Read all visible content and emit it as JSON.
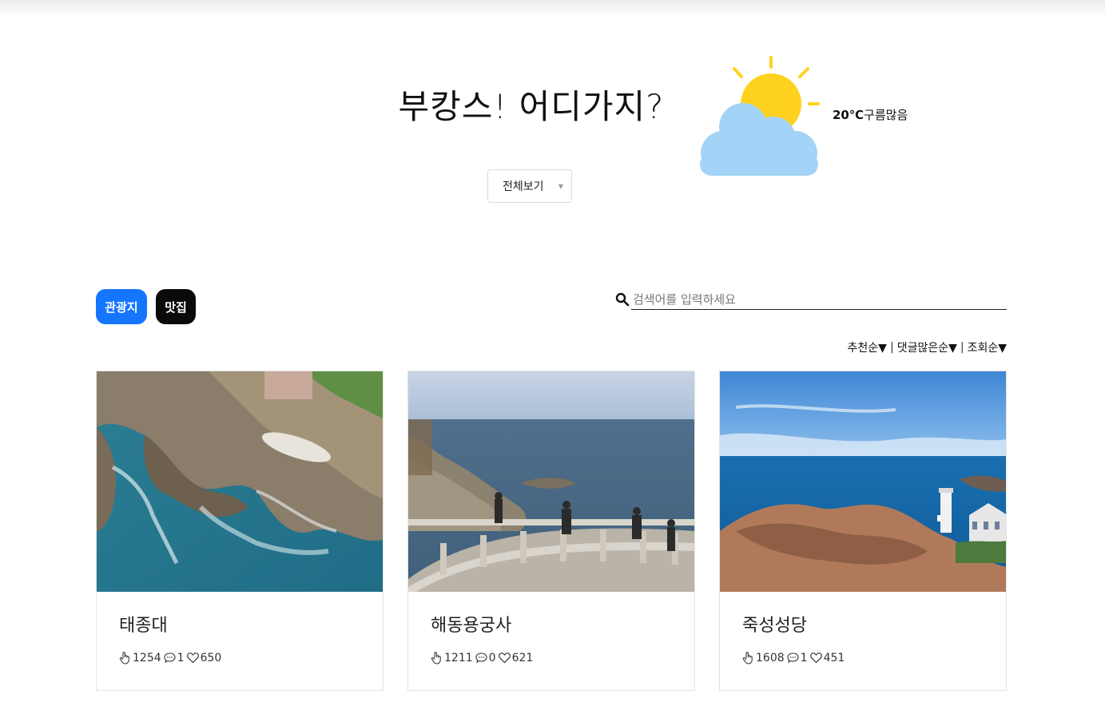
{
  "header": {
    "title": "부캉스! 어디가지?",
    "filter_selected": "전체보기"
  },
  "weather": {
    "icon": "partly-cloudy-icon",
    "temperature": "20℃",
    "condition": "구름많음"
  },
  "categories": [
    {
      "label": "관광지",
      "color": "#1476ff",
      "active": true
    },
    {
      "label": "맛집",
      "color": "#0a0a0a",
      "active": false
    }
  ],
  "search": {
    "placeholder": "검색어를 입력하세요"
  },
  "sort": [
    {
      "label": "추천순▼"
    },
    {
      "label": "댓글많은순▼"
    },
    {
      "label": "조회순▼"
    }
  ],
  "places": [
    {
      "name": "태종대",
      "likes": "1254",
      "comments": "1",
      "favorites": "650"
    },
    {
      "name": "해동용궁사",
      "likes": "1211",
      "comments": "0",
      "favorites": "621"
    },
    {
      "name": "죽성성당",
      "likes": "1608",
      "comments": "1",
      "favorites": "451"
    }
  ],
  "colors": {
    "accent": "#1476ff",
    "sun": "#ffd21f",
    "cloud": "#a3d4f7"
  }
}
